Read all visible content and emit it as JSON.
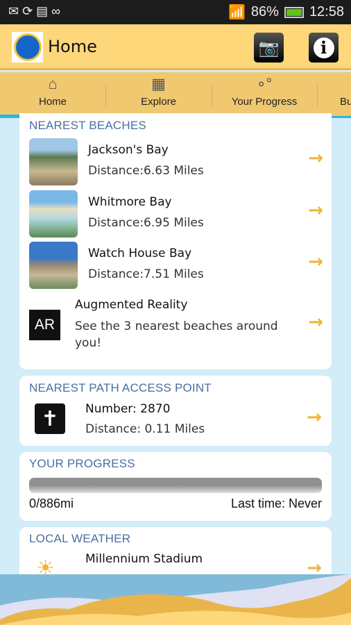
{
  "status_bar": {
    "battery": "86%",
    "time": "12:58"
  },
  "header": {
    "title": "Home"
  },
  "tabs": [
    {
      "label": "Home",
      "icon": "home-icon"
    },
    {
      "label": "Explore",
      "icon": "map-icon"
    },
    {
      "label": "Your Progress",
      "icon": "progress-icon"
    },
    {
      "label": "Bu"
    }
  ],
  "nearest_beaches": {
    "heading": "NEAREST BEACHES",
    "items": [
      {
        "name": "Jackson's Bay",
        "distance": "Distance:6.63 Miles"
      },
      {
        "name": "Whitmore Bay",
        "distance": "Distance:6.95 Miles"
      },
      {
        "name": "Watch House Bay",
        "distance": "Distance:7.51 Miles"
      }
    ],
    "ar": {
      "badge": "AR",
      "title": "Augmented Reality",
      "desc": "See the 3 nearest beaches around you!"
    }
  },
  "path_access": {
    "heading": "NEAREST PATH ACCESS POINT",
    "number": "Number: 2870",
    "distance": "Distance: 0.11 Miles"
  },
  "progress": {
    "heading": "YOUR PROGRESS",
    "value": "0/886mi",
    "fraction": 0,
    "last": "Last time: Never"
  },
  "weather": {
    "heading": "LOCAL WEATHER",
    "location": "Millennium Stadium"
  },
  "colors": {
    "header": "#fdd77a",
    "tabs": "#f0c870",
    "accent": "#29b5e5",
    "heading": "#4a6ea0",
    "arrow": "#f0b43c"
  }
}
